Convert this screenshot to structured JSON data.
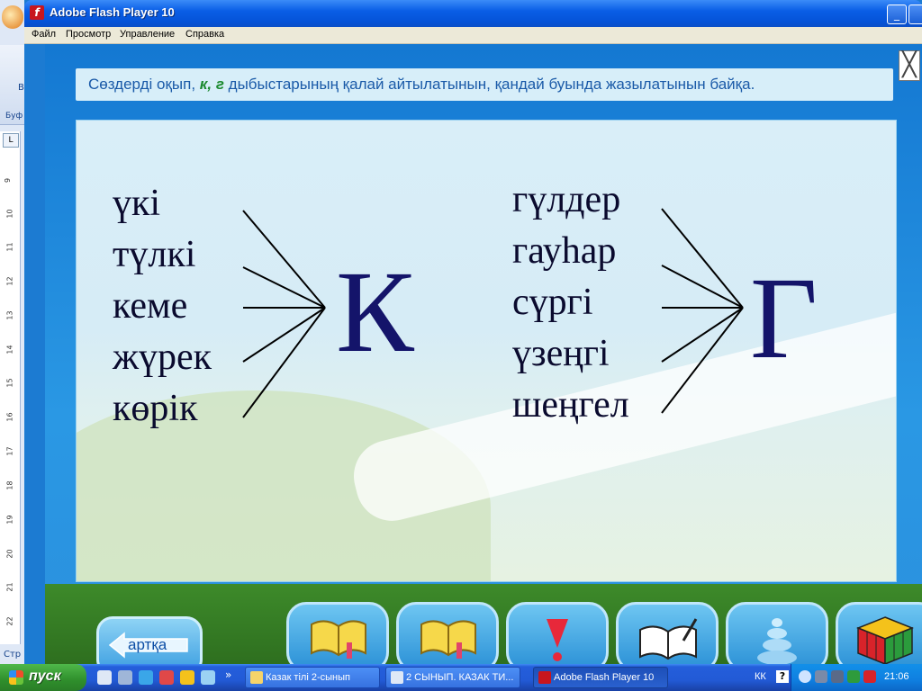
{
  "background_window": {
    "ribbon_letter": "В",
    "ribbon_caption": "Буф",
    "status_text": "Стр",
    "ruler_numbers": [
      "9",
      "10",
      "11",
      "12",
      "13",
      "14",
      "15",
      "16",
      "17",
      "18",
      "19",
      "20",
      "21",
      "22"
    ]
  },
  "window": {
    "title": "Adobe Flash Player 10",
    "menu": [
      "Файл",
      "Просмотр",
      "Управление",
      "Справка"
    ]
  },
  "content": {
    "instruction_prefix": "Сөздерді оқып, ",
    "instruction_highlight": "к, г",
    "instruction_suffix": " дыбыстарының қалай айтылатынын, қандай буында жазылатынын байқа.",
    "close_symbol": "╳",
    "left_words": [
      "үкі",
      "түлкі",
      "кеме",
      "жүрек",
      "көрік"
    ],
    "left_letter": "К",
    "right_words": [
      "гүлдер",
      "гауһар",
      "сүргі",
      "үзеңгі",
      "шеңгел"
    ],
    "right_letter": "Г",
    "back_label": "артқа",
    "nav_buttons": [
      "book-icon",
      "book-icon",
      "exclamation-icon",
      "open-book-pen-icon",
      "pyramid-icon",
      "rubik-cube-icon"
    ]
  },
  "taskbar": {
    "start_label": "пуск",
    "items": [
      "Казак тілі 2-сынып",
      "2 СЫНЫП. КАЗАК ТИ...",
      "Adobe Flash Player 10"
    ],
    "language": "КК",
    "clock": "21:06"
  },
  "colors": {
    "instruction_text": "#1a5aa8",
    "highlight": "#1b8a2f",
    "letters": "#14146a"
  }
}
